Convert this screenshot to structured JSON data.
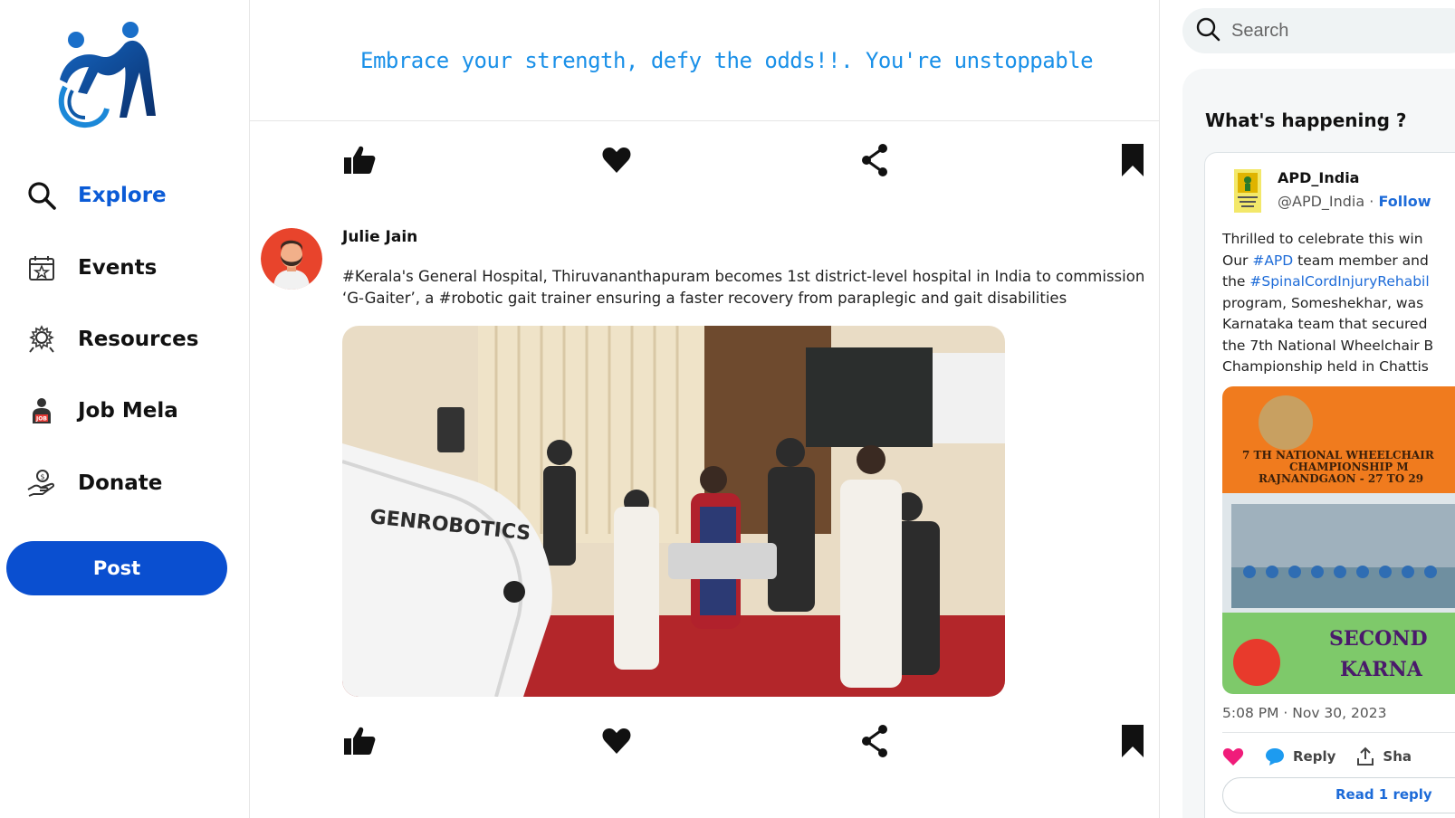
{
  "sidebar": {
    "logo_alt": "app-logo",
    "items": [
      {
        "label": "Explore",
        "icon": "search-icon",
        "active": true
      },
      {
        "label": "Events",
        "icon": "calendar-star-icon",
        "active": false
      },
      {
        "label": "Resources",
        "icon": "gear-brain-icon",
        "active": false
      },
      {
        "label": "Job Mela",
        "icon": "job-person-icon",
        "active": false
      },
      {
        "label": "Donate",
        "icon": "donate-hand-icon",
        "active": false
      }
    ],
    "post_button": "Post"
  },
  "main": {
    "banner": "Embrace your strength, defy the odds!!. You're unstoppable",
    "post": {
      "author": "Julie Jain",
      "text": "#Kerala's General Hospital, Thiruvananthapuram becomes 1st district-level hospital in India to commission ‘G-Gaiter’, a #robotic gait trainer ensuring a faster recovery from paraplegic and gait disabilities",
      "image_text": "GENROBOTICS"
    },
    "actions": [
      "like-icon",
      "heart-icon",
      "share-icon",
      "bookmark-icon"
    ]
  },
  "right": {
    "search_placeholder": "Search",
    "happening_title": "What's happening ?",
    "tweet": {
      "name": "APD_India",
      "handle": "@APD_India",
      "separator": " · ",
      "follow": "Follow",
      "lines": [
        {
          "parts": [
            {
              "t": "Thrilled to celebrate this win"
            }
          ]
        },
        {
          "parts": [
            {
              "t": "Our "
            },
            {
              "t": "#APD",
              "link": true
            },
            {
              "t": " team member and"
            }
          ]
        },
        {
          "parts": [
            {
              "t": "the "
            },
            {
              "t": "#SpinalCordInjuryRehabil",
              "link": true
            }
          ]
        },
        {
          "parts": [
            {
              "t": "program, Someshekhar, was"
            }
          ]
        },
        {
          "parts": [
            {
              "t": "Karnataka team that secured"
            }
          ]
        },
        {
          "parts": [
            {
              "t": "the 7th National Wheelchair B"
            }
          ]
        },
        {
          "parts": [
            {
              "t": "Championship held in Chattis"
            }
          ]
        }
      ],
      "image_texts": [
        "7 TH NATIONAL WHEELCHAIR",
        "CHAMPIONSHIP M",
        "RAJNANDGAON - 27 TO 29",
        "SECOND",
        "KARNA"
      ],
      "time": "5:08 PM · Nov 30, 2023",
      "reply_label": "Reply",
      "share_label": "Sha",
      "read_more": "Read 1 reply"
    }
  },
  "colors": {
    "accent": "#0a4fd0",
    "link": "#1d6bd8",
    "banner": "#1a90e8",
    "like": "#f01c7a"
  }
}
